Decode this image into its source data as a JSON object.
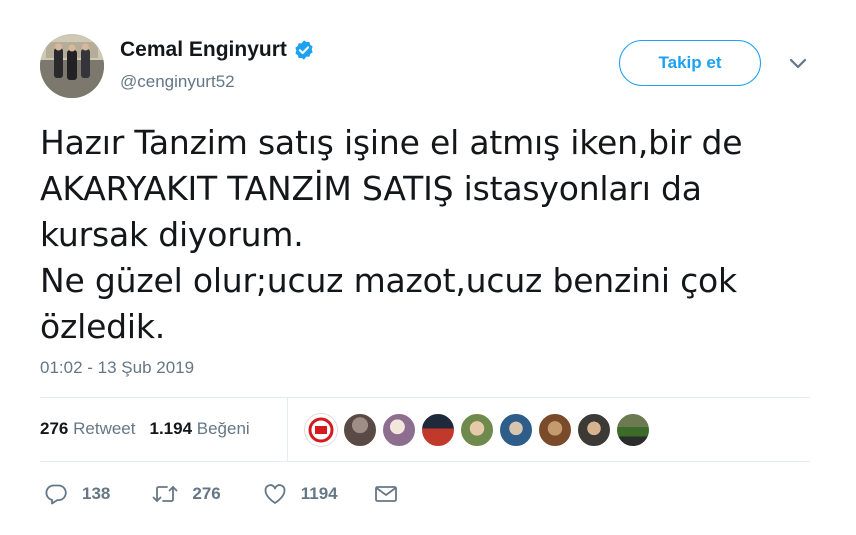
{
  "author": {
    "display_name": "Cemal Enginyurt",
    "handle": "@cenginyurt52",
    "verified": true
  },
  "follow_button": {
    "label": "Takip et"
  },
  "tweet": {
    "lines": [
      "Hazır Tanzim satış işine el atmış iken,bir de",
      "AKARYAKIT TANZİM SATIŞ istasyonları da",
      "kursak diyorum.",
      "Ne güzel olur;ucuz mazot,ucuz benzini çok",
      "özledik."
    ],
    "timestamp": "01:02 - 13 Şub 2019"
  },
  "stats": {
    "retweet_count": "276",
    "retweet_label": "Retweet",
    "like_count": "1.194",
    "like_label": "Beğeni"
  },
  "actions": {
    "reply_count": "138",
    "retweet_count": "276",
    "like_count": "1194"
  },
  "colors": {
    "accent": "#1da1f2",
    "secondary_text": "#657786",
    "divider": "#e6ecf0"
  }
}
